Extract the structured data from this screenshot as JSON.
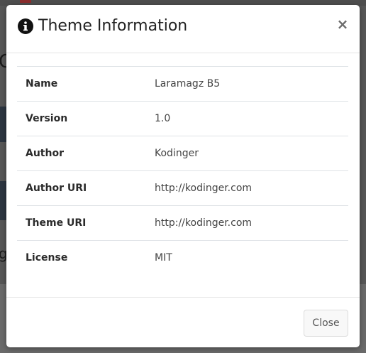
{
  "modal": {
    "title": "Theme Information",
    "close_symbol": "×",
    "icon": "info-circle-icon"
  },
  "theme_info": {
    "rows": [
      {
        "key": "Name",
        "value": "Laramagz B5"
      },
      {
        "key": "Version",
        "value": "1.0"
      },
      {
        "key": "Author",
        "value": "Kodinger"
      },
      {
        "key": "Author URI",
        "value": "http://kodinger.com"
      },
      {
        "key": "Theme URI",
        "value": "http://kodinger.com"
      },
      {
        "key": "License",
        "value": "MIT"
      }
    ]
  },
  "footer": {
    "close_label": "Close"
  },
  "colors": {
    "backdrop": "#575757",
    "modal_bg": "#ffffff",
    "border": "#dee2e6"
  }
}
